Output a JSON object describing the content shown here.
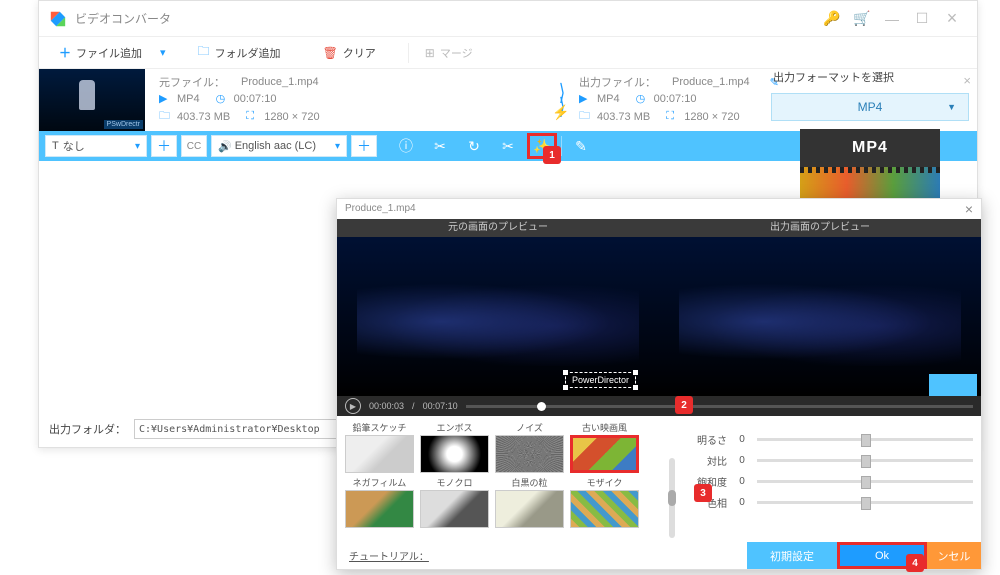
{
  "app": {
    "title": "ビデオコンバータ"
  },
  "toolbar": {
    "add_file": "ファイル追加",
    "add_folder": "フォルダ追加",
    "clear": "クリア",
    "merge": "マージ"
  },
  "source": {
    "label_prefix": "元ファイル：",
    "filename": "Produce_1.mp4",
    "format": "MP4",
    "duration": "00:07:10",
    "size": "403.73 MB",
    "resolution": "1280 × 720"
  },
  "output": {
    "label_prefix": "出力ファイル：",
    "filename": "Produce_1.mp4",
    "format": "MP4",
    "duration": "00:07:10",
    "size": "403.73 MB",
    "resolution": "1280 × 720"
  },
  "bluebar": {
    "subtitle": "なし",
    "audio_track": "English aac (LC)"
  },
  "format_panel": {
    "title": "出力フォーマットを選択",
    "selected": "MP4",
    "tile_label": "MP4"
  },
  "output_folder": {
    "label": "出力フォルダ：",
    "path": "C:¥Users¥Administrator¥Desktop"
  },
  "fx": {
    "title": "Produce_1.mp4",
    "src_preview_label": "元の画面のプレビュー",
    "out_preview_label": "出力画面のプレビュー",
    "watermark_text": "PowerDirector",
    "time_current": "00:00:03",
    "time_total": "00:07:10",
    "effects": [
      "鉛筆スケッチ",
      "エンボス",
      "ノイズ",
      "古い映画風",
      "ネガフィルム",
      "モノクロ",
      "白黒の粒",
      "モザイク"
    ],
    "sliders": {
      "brightness": {
        "label": "明るさ",
        "value": "0"
      },
      "contrast": {
        "label": "対比",
        "value": "0"
      },
      "saturation": {
        "label": "飽和度",
        "value": "0"
      },
      "hue": {
        "label": "色相",
        "value": "0"
      }
    },
    "tutorial": "チュートリアル：",
    "btn_reset": "初期設定",
    "btn_ok": "Ok",
    "btn_cancel": "ンセル"
  },
  "callouts": {
    "c1": "1",
    "c2": "2",
    "c3": "3",
    "c4": "4"
  }
}
